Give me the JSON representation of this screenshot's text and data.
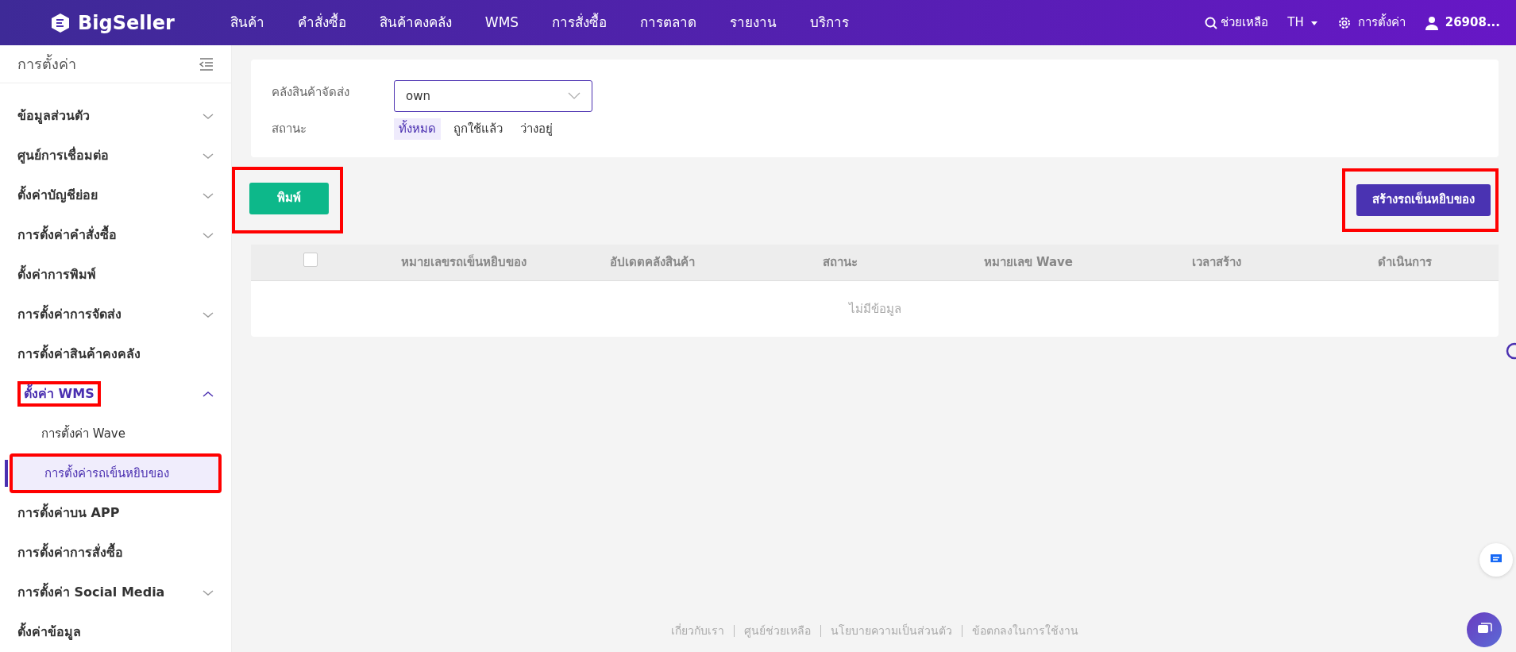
{
  "topbar": {
    "logo": "BigSeller",
    "nav": [
      "สินค้า",
      "คำสั่งซื้อ",
      "สินค้าคงคลัง",
      "WMS",
      "การสั่งซื้อ",
      "การตลาด",
      "รายงาน",
      "บริการ"
    ],
    "help": "ช่วยเหลือ",
    "language": "TH",
    "settings": "การตั้งค่า",
    "user": "26908..."
  },
  "sidebar": {
    "title": "การตั้งค่า",
    "items": [
      {
        "label": "ข้อมูลส่วนตัว",
        "kind": "group",
        "expanded": false,
        "highlighted": false
      },
      {
        "label": "ศูนย์การเชื่อมต่อ",
        "kind": "group",
        "expanded": false,
        "highlighted": false
      },
      {
        "label": "ตั้งค่าบัญชีย่อย",
        "kind": "group",
        "expanded": false,
        "highlighted": false
      },
      {
        "label": "การตั้งค่าคำสั่งซื้อ",
        "kind": "group",
        "expanded": false,
        "highlighted": false
      },
      {
        "label": "ตั้งค่าการพิมพ์",
        "kind": "link",
        "highlighted": false
      },
      {
        "label": "การตั้งค่าการจัดส่ง",
        "kind": "group",
        "expanded": false,
        "highlighted": false
      },
      {
        "label": "การตั้งค่าสินค้าคงคลัง",
        "kind": "link",
        "highlighted": false
      },
      {
        "label": "ตั้งค่า WMS",
        "kind": "group",
        "expanded": true,
        "highlighted": true,
        "children": [
          {
            "label": "การตั้งค่า Wave",
            "selected": false,
            "highlighted": false
          },
          {
            "label": "การตั้งค่ารถเข็นหยิบของ",
            "selected": true,
            "highlighted": true
          }
        ]
      },
      {
        "label": "การตั้งค่าบน APP",
        "kind": "link",
        "highlighted": false
      },
      {
        "label": "การตั้งค่าการสั่งซื้อ",
        "kind": "link",
        "highlighted": false
      },
      {
        "label": "การตั้งค่า Social Media",
        "kind": "group",
        "expanded": false,
        "highlighted": false
      },
      {
        "label": "ตั้งค่าข้อมูล",
        "kind": "link",
        "highlighted": false
      }
    ]
  },
  "filters": {
    "warehouse_label": "คลังสินค้าจัดส่ง",
    "warehouse_value": "own",
    "status_label": "สถานะ",
    "status_options": [
      {
        "label": "ทั้งหมด",
        "selected": true
      },
      {
        "label": "ถูกใช้แล้ว",
        "selected": false
      },
      {
        "label": "ว่างอยู่",
        "selected": false
      }
    ]
  },
  "actions": [
    {
      "label": "พิมพ์",
      "kind": "print",
      "highlighted": true
    },
    {
      "label": "สร้างรถเข็นหยิบของ",
      "kind": "create",
      "highlighted": true
    }
  ],
  "table": {
    "select_all_checked": false,
    "columns": [
      "หมายเลขรถเข็นหยิบของ",
      "อัปเดตคลังสินค้า",
      "สถานะ",
      "หมายเลข Wave",
      "เวลาสร้าง",
      "ดำเนินการ"
    ],
    "empty_text": "ไม่มีข้อมูล"
  },
  "footer": {
    "links": [
      "เกี่ยวกับเรา",
      "ศูนย์ช่วยเหลือ",
      "นโยบายความเป็นส่วนตัว",
      "ข้อตกลงในการใช้งาน"
    ]
  }
}
